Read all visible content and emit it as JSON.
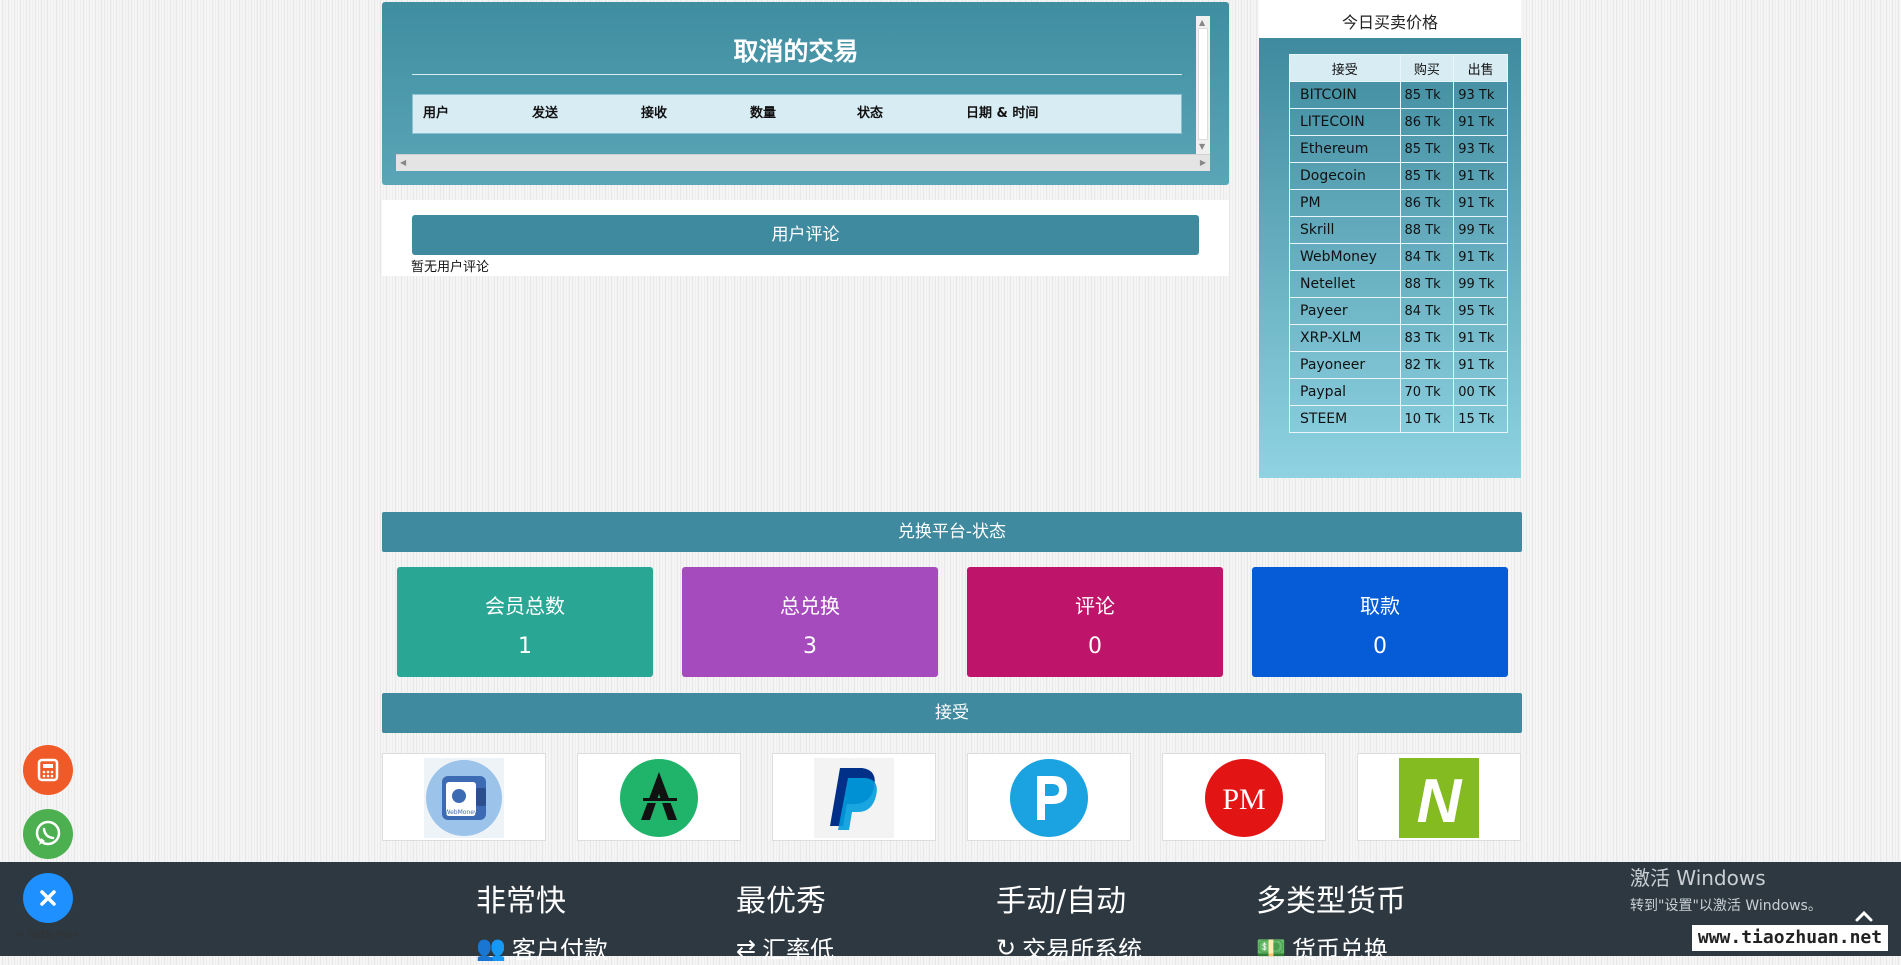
{
  "cancel": {
    "title": "取消的交易",
    "headers": [
      "用户",
      "发送",
      "接收",
      "数量",
      "状态",
      "日期 & 时间"
    ]
  },
  "reviews": {
    "title": "用户评论",
    "empty": "暂无用户评论"
  },
  "price": {
    "title": "今日买卖价格",
    "headers": [
      "接受",
      "购买",
      "出售"
    ],
    "rows": [
      {
        "name": "BITCOIN",
        "buy": "85 Tk",
        "sell": "93 Tk"
      },
      {
        "name": "LITECOIN",
        "buy": "86 Tk",
        "sell": "91 Tk"
      },
      {
        "name": "Ethereum",
        "buy": "85 Tk",
        "sell": "93 Tk"
      },
      {
        "name": "Dogecoin",
        "buy": "85 Tk",
        "sell": "91 Tk"
      },
      {
        "name": "PM",
        "buy": "86 Tk",
        "sell": "91 Tk"
      },
      {
        "name": "Skrill",
        "buy": "88 Tk",
        "sell": "99 Tk"
      },
      {
        "name": "WebMoney",
        "buy": "84 Tk",
        "sell": "91 Tk"
      },
      {
        "name": "Netellet",
        "buy": "88 Tk",
        "sell": "99 Tk"
      },
      {
        "name": "Payeer",
        "buy": "84 Tk",
        "sell": "95 Tk"
      },
      {
        "name": "XRP-XLM",
        "buy": "83 Tk",
        "sell": "91 Tk"
      },
      {
        "name": "Payoneer",
        "buy": "82 Tk",
        "sell": "91 Tk"
      },
      {
        "name": "Paypal",
        "buy": "70 Tk",
        "sell": "00 TK"
      },
      {
        "name": "STEEM",
        "buy": "10 Tk",
        "sell": "15 Tk"
      }
    ]
  },
  "stats": {
    "title": "兑换平台-状态",
    "cards": [
      {
        "label": "会员总数",
        "value": "1",
        "color": "#2aa695"
      },
      {
        "label": "总兑换",
        "value": "3",
        "color": "#a64bbd"
      },
      {
        "label": "评论",
        "value": "0",
        "color": "#be1469"
      },
      {
        "label": "取款",
        "value": "0",
        "color": "#065bd6"
      }
    ]
  },
  "accept": {
    "title": "接受",
    "logos": [
      "webmoney-logo",
      "airtm-logo",
      "paypal-logo",
      "payeer-logo",
      "perfect-money-logo",
      "neteller-logo"
    ],
    "webmoney_caption": "WebMoney",
    "pm_text": "PM",
    "n_text": "N"
  },
  "footer": {
    "features": [
      {
        "title": "非常快",
        "sub": "客户付款",
        "icon": "users-icon"
      },
      {
        "title": "最优秀",
        "sub": "汇率低",
        "icon": "exchange-icon"
      },
      {
        "title": "手动/自动",
        "sub": "交易所系统",
        "icon": "refresh-icon"
      },
      {
        "title": "多类型货币",
        "sub": "货币兑换",
        "icon": "money-icon"
      }
    ]
  },
  "getbutton": "GetButton",
  "windows": {
    "line1": "激活 Windows",
    "line2": "转到\"设置\"以激活 Windows。"
  },
  "watermark": "www.tiaozhuan.net"
}
